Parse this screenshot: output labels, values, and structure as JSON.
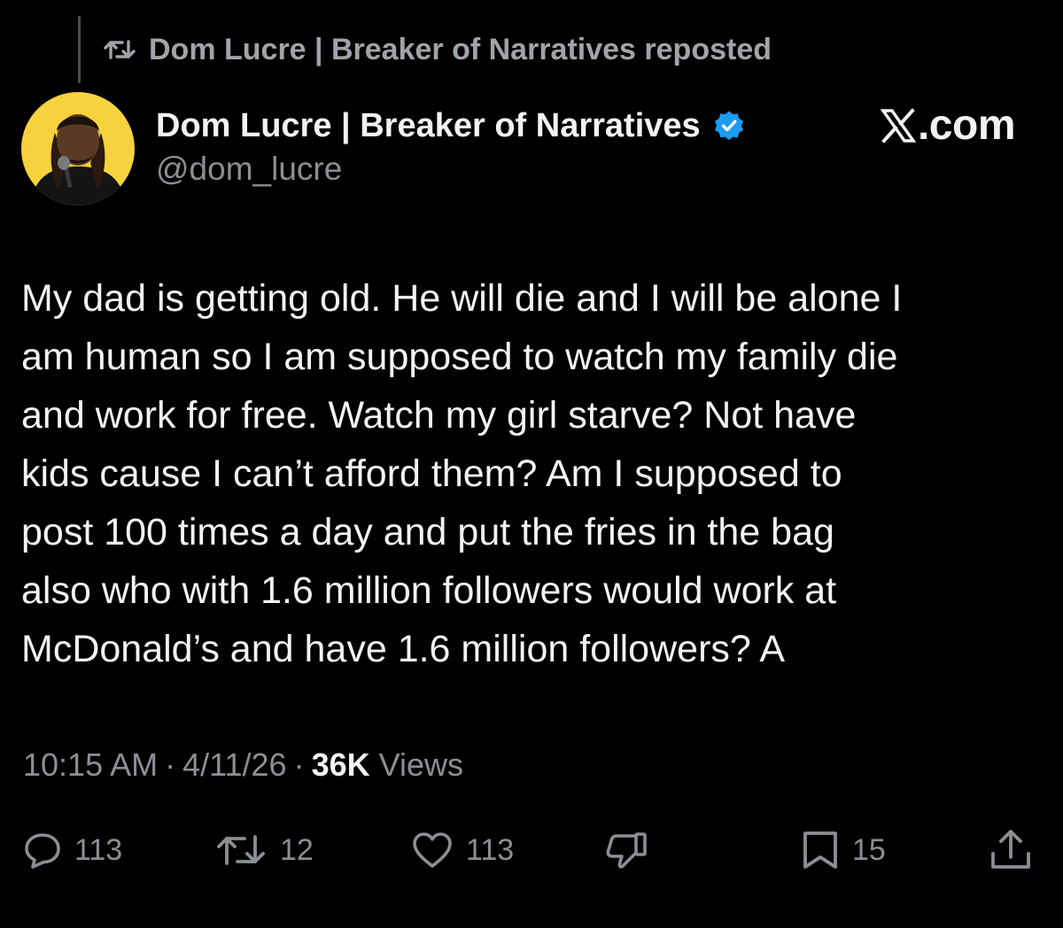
{
  "repost": {
    "icon": "repost-icon",
    "text": "Dom Lucre | Breaker of Narratives reposted"
  },
  "author": {
    "display_name": "Dom Lucre | Breaker of Narratives",
    "handle": "@dom_lucre",
    "verified": true,
    "avatar_bg": "#f7d23e"
  },
  "brand": {
    "text": ".com",
    "icon": "x-logo-icon"
  },
  "post": {
    "lines": [
      "My dad is getting old. He will die and I will be alone I",
      "am human so I am supposed to watch my family die",
      "and work for free. Watch my girl starve? Not have",
      "kids cause I can’t afford them? Am I supposed to",
      "post 100 times a day and put the fries in the bag",
      "also who with 1.6 million followers would work at",
      "McDonald’s and have 1.6 million followers? A"
    ]
  },
  "meta": {
    "time": "10:15 AM",
    "separator": "·",
    "date": "4/11/26",
    "views_count": "36K",
    "views_label": "Views"
  },
  "actions": {
    "replies": "113",
    "reposts": "12",
    "likes": "113",
    "bookmarks": "15"
  },
  "colors": {
    "background": "#000000",
    "text": "#f2f3f4",
    "secondary": "#8b8f94",
    "verified": "#1d9bf0"
  }
}
